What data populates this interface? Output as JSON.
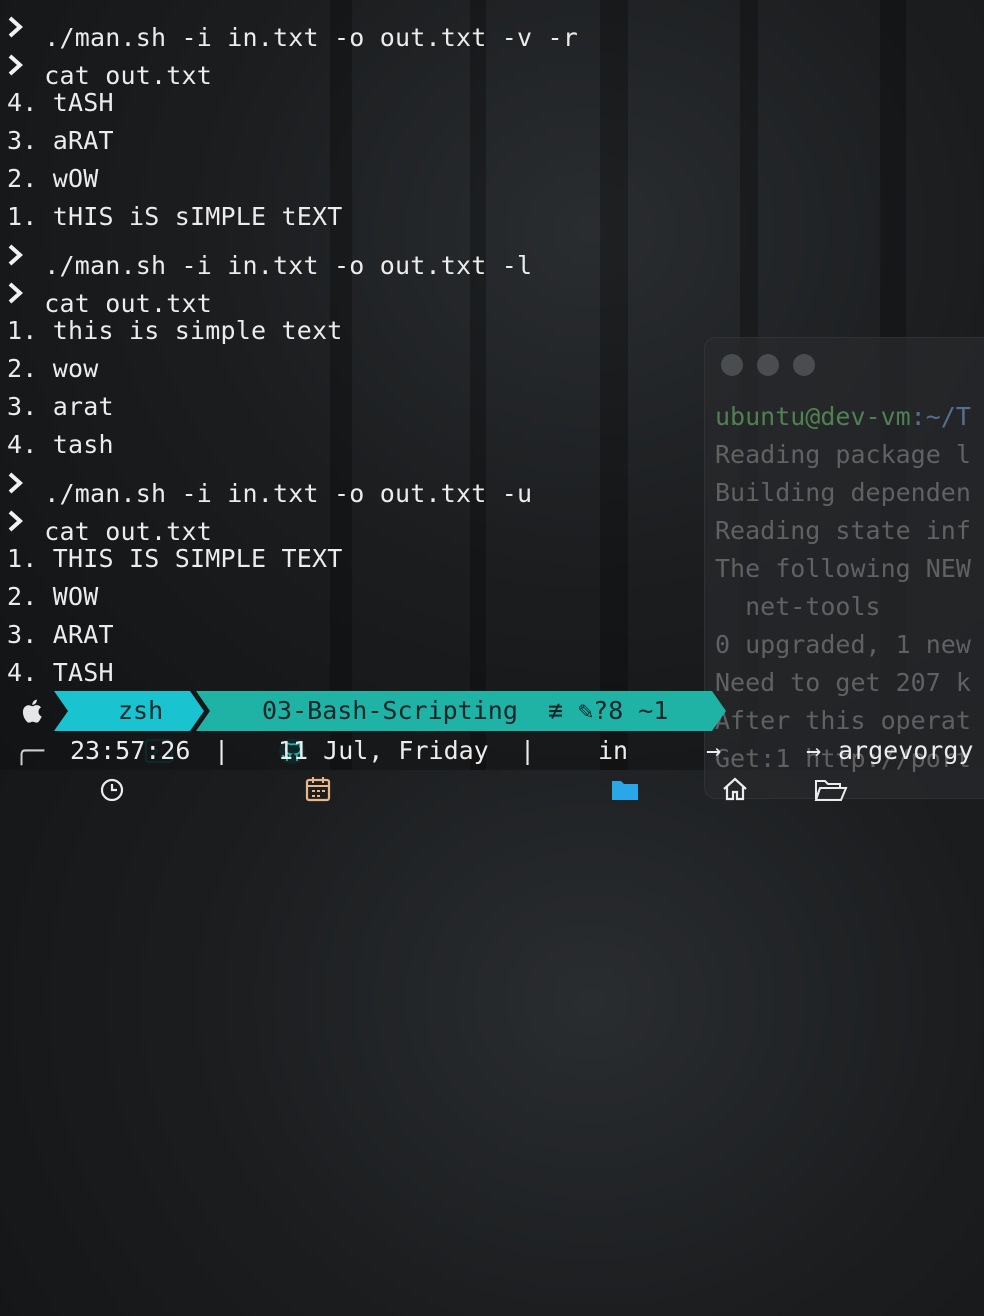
{
  "terminal": {
    "lines": [
      {
        "prompt": true,
        "text": "./man.sh -i in.txt -o out.txt -v -r"
      },
      {
        "prompt": true,
        "text": "cat out.txt"
      },
      {
        "prompt": false,
        "text": "4. tASH"
      },
      {
        "prompt": false,
        "text": "3. aRAT"
      },
      {
        "prompt": false,
        "text": "2. wOW"
      },
      {
        "prompt": false,
        "text": "1. tHIS iS sIMPLE tEXT"
      },
      {
        "prompt": true,
        "text": "./man.sh -i in.txt -o out.txt -l"
      },
      {
        "prompt": true,
        "text": "cat out.txt"
      },
      {
        "prompt": false,
        "text": "1. this is simple text"
      },
      {
        "prompt": false,
        "text": "2. wow"
      },
      {
        "prompt": false,
        "text": "3. arat"
      },
      {
        "prompt": false,
        "text": "4. tash"
      },
      {
        "prompt": true,
        "text": "./man.sh -i in.txt -o out.txt -u"
      },
      {
        "prompt": true,
        "text": "cat out.txt"
      },
      {
        "prompt": false,
        "text": "1. THIS IS SIMPLE TEXT"
      },
      {
        "prompt": false,
        "text": "2. WOW"
      },
      {
        "prompt": false,
        "text": "3. ARAT"
      },
      {
        "prompt": false,
        "text": "4. TASH"
      }
    ]
  },
  "background_window": {
    "user": "ubuntu@dev-vm",
    "path": ":~/T",
    "lines": [
      "Reading package l",
      "Building dependen",
      "Reading state inf",
      "The following NEW",
      "  net-tools",
      "0 upgraded, 1 new",
      "Need to get 207 k",
      "After this operat",
      "Get:1 http://port"
    ]
  },
  "powerline": {
    "shell_icon": ">_",
    "shell": "zsh",
    "repo": "03-Bash-Scripting",
    "git_status": "≢ ✎?8 ~1"
  },
  "status": {
    "time": "23:57:26",
    "date": "11 Jul, Friday",
    "dir": "in",
    "path_end": "argevorgy",
    "separator": "|"
  },
  "icons": {
    "prompt": "chevron-right",
    "apple": "apple-logo",
    "github": "github-logo",
    "clock": "clock",
    "calendar": "calendar",
    "folder": "folder",
    "home": "home",
    "arrow": "arrow-right",
    "open-folder": "folder-open"
  },
  "colors": {
    "shell_segment": "#19c3cf",
    "git_segment": "#1fb3a6",
    "folder": "#2aa7e8",
    "calendar": "#e9b88a"
  }
}
